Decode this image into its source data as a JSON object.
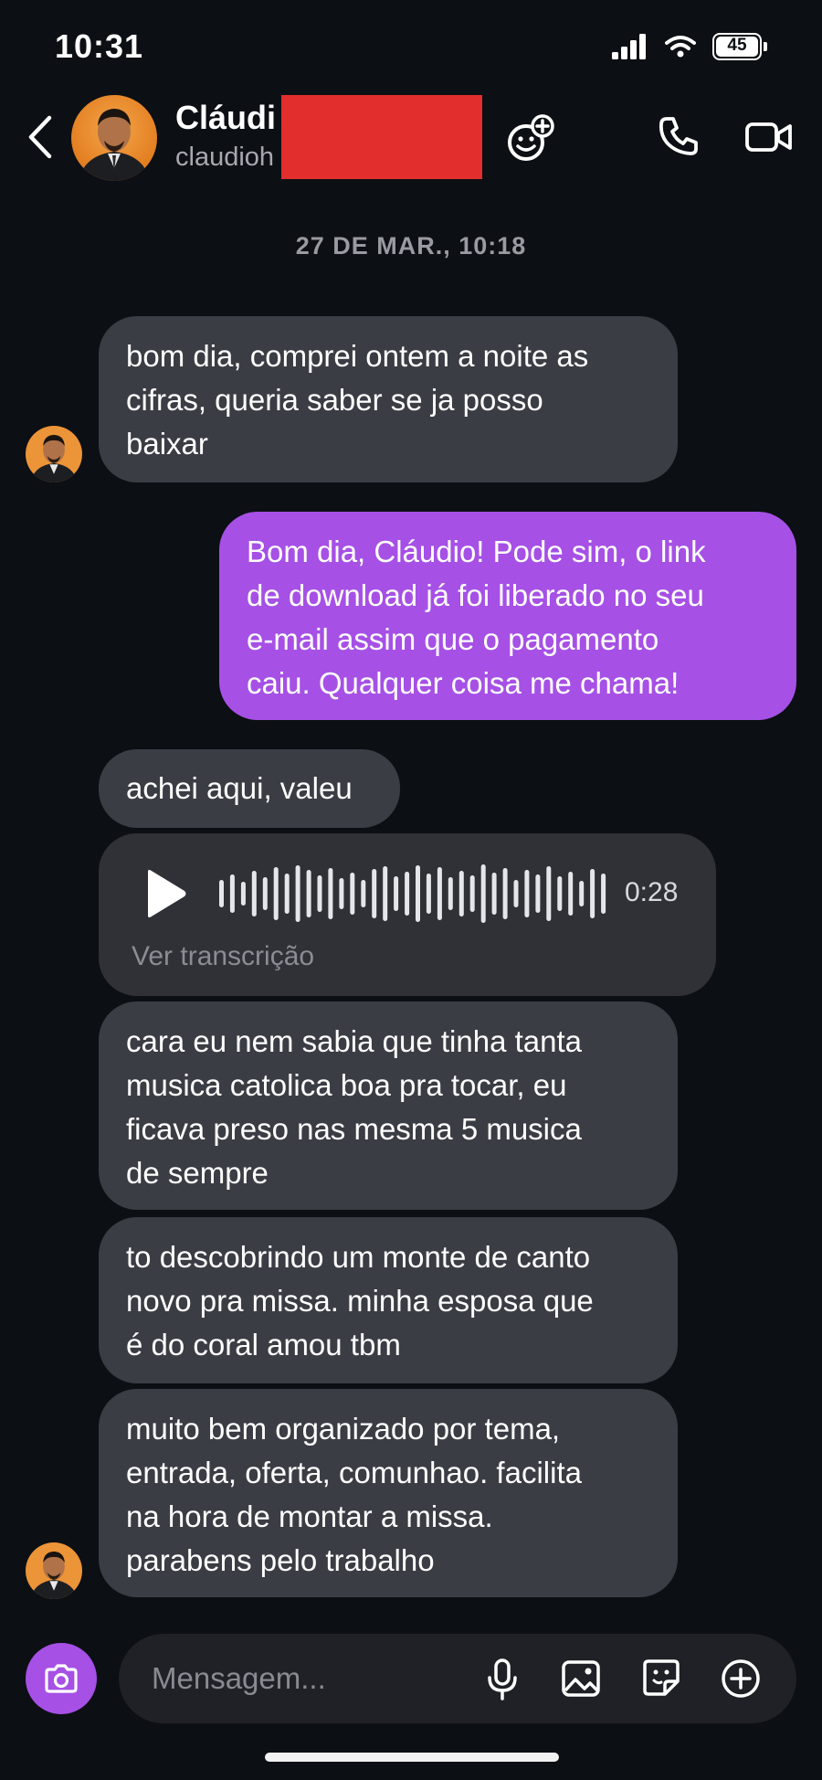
{
  "status_bar": {
    "time": "10:31",
    "battery": "45"
  },
  "header": {
    "name": "Cláudi",
    "handle": "claudioh"
  },
  "date_separator": "27 DE MAR., 10:18",
  "messages": [
    {
      "direction": "incoming",
      "lines": [
        "bom dia, comprei ontem a noite as",
        "cifras, queria saber se ja posso",
        "baixar"
      ]
    },
    {
      "direction": "outgoing",
      "lines": [
        "Bom dia, Cláudio! Pode sim, o link",
        "de download já foi liberado no seu",
        "e-mail assim que o pagamento",
        "caiu. Qualquer coisa me chama!"
      ]
    },
    {
      "direction": "incoming",
      "lines": [
        "achei aqui, valeu"
      ]
    },
    {
      "direction": "incoming",
      "type": "audio",
      "duration": "0:28",
      "transcript_label": "Ver transcrição"
    },
    {
      "direction": "incoming",
      "lines": [
        "cara eu nem sabia que tinha tanta",
        "musica catolica boa pra tocar, eu",
        "ficava preso nas mesma 5 musica",
        "de sempre"
      ]
    },
    {
      "direction": "incoming",
      "lines": [
        "to descobrindo um monte de canto",
        "novo pra missa. minha esposa que",
        "é do coral amou tbm"
      ]
    },
    {
      "direction": "incoming",
      "lines": [
        "muito bem organizado por tema,",
        "entrada, oferta, comunhao. facilita",
        "na hora de montar a missa.",
        "parabens pelo trabalho"
      ]
    }
  ],
  "composer": {
    "placeholder": "Mensagem..."
  },
  "colors": {
    "background": "#0c0f14",
    "incoming_bubble": "#3b3d44",
    "outgoing_bubble": "#a650e6",
    "redaction": "#e22e2c"
  },
  "icons": [
    "back-icon",
    "add-emoji-icon",
    "phone-icon",
    "video-icon",
    "play-icon",
    "camera-icon",
    "mic-icon",
    "gallery-icon",
    "sticker-icon",
    "plus-icon"
  ]
}
